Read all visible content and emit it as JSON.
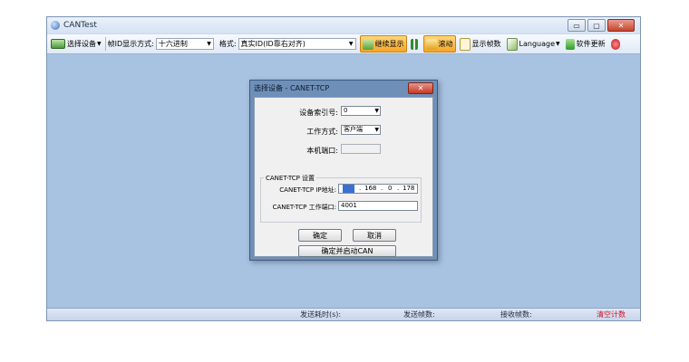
{
  "window": {
    "title": "CANTest",
    "controls": {
      "minimize": "▭",
      "maximize": "▢",
      "close": "✕"
    }
  },
  "toolbar": {
    "select_device": "选择设备",
    "frame_id_label": "帧ID显示方式:",
    "frame_id_value": "十六进制",
    "format_label": "格式:",
    "format_value": "真实ID(ID靠右对齐)",
    "continue_display": "继续显示",
    "scroll": "滚动",
    "show_frames": "显示帧数",
    "language": "Language",
    "software_update": "软件更新"
  },
  "statusbar": {
    "send_time": "发送耗时(s):",
    "sent_frames": "发送帧数:",
    "recv_frames": "接收帧数:",
    "clear_count": "清空计数"
  },
  "dialog": {
    "title": "选择设备 - CANET-TCP",
    "index_label": "设备索引号:",
    "index_value": "0",
    "mode_label": "工作方式:",
    "mode_value": "客户端",
    "local_port_label": "本机端口:",
    "group_title": "CANET-TCP 设置",
    "ip_label": "CANET-TCP IP地址:",
    "ip": [
      "192",
      "168",
      "0",
      "178"
    ],
    "work_port_label": "CANET-TCP 工作端口:",
    "work_port_value": "4001",
    "ok": "确定",
    "cancel": "取消",
    "ok_start": "确定并启动CAN"
  },
  "colors": {
    "client_bg": "#a8c2e2",
    "highlight": "#f6a527",
    "status_red": "#d4102a"
  }
}
